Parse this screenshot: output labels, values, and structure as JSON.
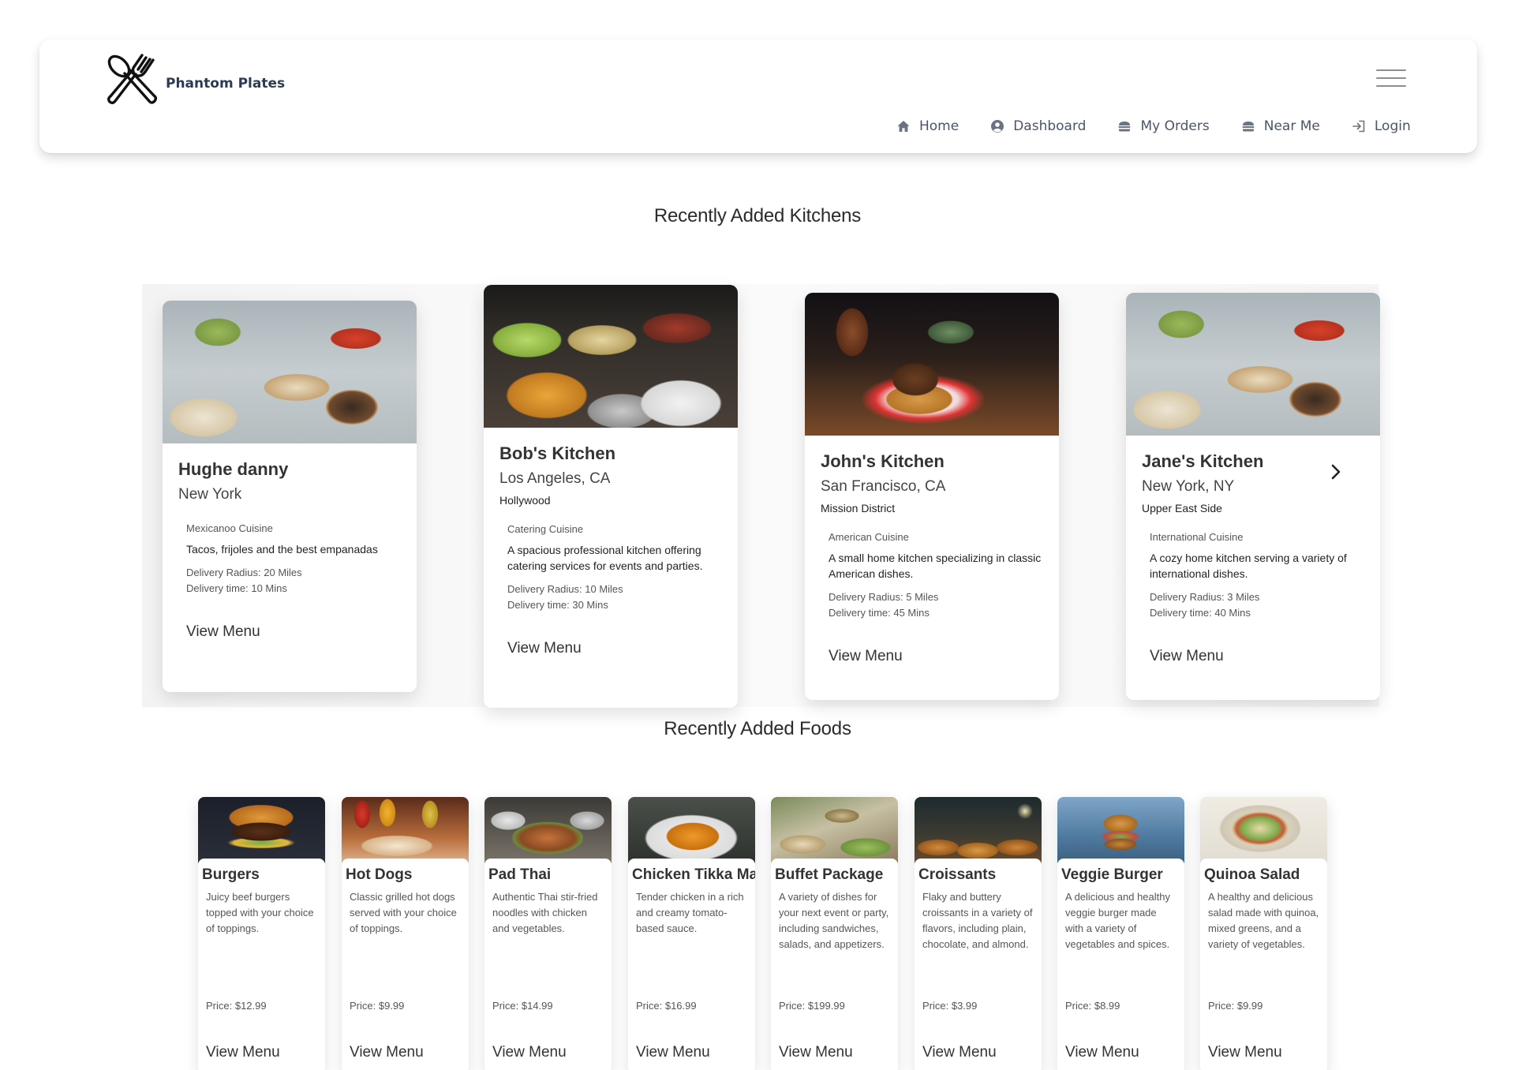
{
  "brand": {
    "name": "Phantom Plates",
    "logo_icon": "fork-knife-icon"
  },
  "nav": [
    {
      "label": "Home",
      "icon": "home-icon"
    },
    {
      "label": "Dashboard",
      "icon": "user-circle-icon"
    },
    {
      "label": "My Orders",
      "icon": "burger-icon"
    },
    {
      "label": "Near Me",
      "icon": "burger-icon"
    },
    {
      "label": "Login",
      "icon": "login-icon"
    }
  ],
  "kitchens_section": {
    "title": "Recently Added Kitchens"
  },
  "kitchens": [
    {
      "name": "Hughe danny",
      "city": "New York",
      "area": "",
      "cuisine": "Mexicanoo Cuisine",
      "description": "Tacos, frijoles and the best empanadas",
      "radius": "Delivery Radius: 20 Miles",
      "time": "Delivery time: 10 Mins",
      "button": "View Menu"
    },
    {
      "name": "Bob's Kitchen",
      "city": "Los Angeles, CA",
      "area": "Hollywood",
      "cuisine": "Catering Cuisine",
      "description": "A spacious professional kitchen offering catering services for events and parties.",
      "radius": "Delivery Radius: 10 Miles",
      "time": "Delivery time: 30 Mins",
      "button": "View Menu"
    },
    {
      "name": "John's Kitchen",
      "city": "San Francisco, CA",
      "area": "Mission District",
      "cuisine": "American Cuisine",
      "description": "A small home kitchen specializing in classic American dishes.",
      "radius": "Delivery Radius: 5 Miles",
      "time": "Delivery time: 45 Mins",
      "button": "View Menu"
    },
    {
      "name": "Jane's Kitchen",
      "city": "New York, NY",
      "area": "Upper East Side",
      "cuisine": "International Cuisine",
      "description": "A cozy home kitchen serving a variety of international dishes.",
      "radius": "Delivery Radius: 3 Miles",
      "time": "Delivery time: 40 Mins",
      "button": "View Menu"
    }
  ],
  "foods_section": {
    "title": "Recently Added Foods"
  },
  "foods": [
    {
      "name": "Burgers",
      "description": "Juicy beef burgers topped with your choice of toppings.",
      "price": "Price: $12.99",
      "button": "View Menu"
    },
    {
      "name": "Hot Dogs",
      "description": "Classic grilled hot dogs served with your choice of toppings.",
      "price": "Price: $9.99",
      "button": "View Menu"
    },
    {
      "name": "Pad Thai",
      "description": "Authentic Thai stir-fried noodles with chicken and vegetables.",
      "price": "Price: $14.99",
      "button": "View Menu"
    },
    {
      "name": "Chicken Tikka Masala",
      "description": "Tender chicken in a rich and creamy tomato-based sauce.",
      "price": "Price: $16.99",
      "button": "View Menu"
    },
    {
      "name": "Buffet Package",
      "description": "A variety of dishes for your next event or party, including sandwiches, salads, and appetizers.",
      "price": "Price: $199.99",
      "button": "View Menu"
    },
    {
      "name": "Croissants",
      "description": "Flaky and buttery croissants in a variety of flavors, including plain, chocolate, and almond.",
      "price": "Price: $3.99",
      "button": "View Menu"
    },
    {
      "name": "Veggie Burger",
      "description": "A delicious and healthy veggie burger made with a variety of vegetables and spices.",
      "price": "Price: $8.99",
      "button": "View Menu"
    },
    {
      "name": "Quinoa Salad",
      "description": "A healthy and delicious salad made with quinoa, mixed greens, and a variety of vegetables.",
      "price": "Price: $9.99",
      "button": "View Menu"
    }
  ]
}
